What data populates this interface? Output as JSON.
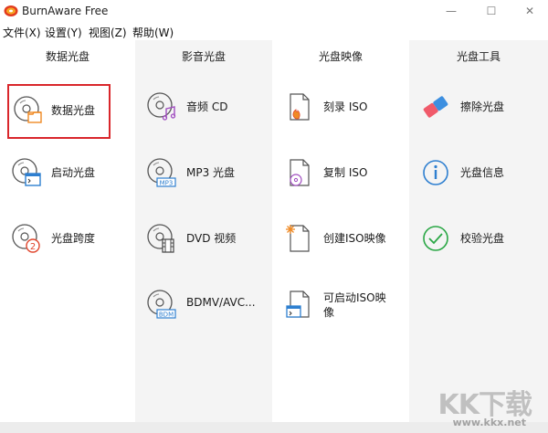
{
  "window": {
    "title": "BurnAware Free"
  },
  "window_controls": {
    "minimize": "—",
    "maximize": "☐",
    "close": "✕"
  },
  "menu": [
    "文件(X)",
    "设置(Y)",
    "视图(Z)",
    "帮助(W)"
  ],
  "columns": [
    {
      "header": "数据光盘",
      "tiles": [
        {
          "label": "数据光盘",
          "icon": "disc-folder-icon",
          "selected": true
        },
        {
          "label": "启动光盘",
          "icon": "disc-terminal-icon",
          "selected": false
        },
        {
          "label": "光盘跨度",
          "icon": "disc-span-icon",
          "selected": false
        }
      ]
    },
    {
      "header": "影音光盘",
      "tiles": [
        {
          "label": "音频 CD",
          "icon": "disc-music-icon"
        },
        {
          "label": "MP3 光盘",
          "icon": "disc-mp3-icon"
        },
        {
          "label": "DVD 视频",
          "icon": "disc-film-icon"
        },
        {
          "label": "BDMV/AVC...",
          "icon": "disc-bdm-icon"
        }
      ]
    },
    {
      "header": "光盘映像",
      "tiles": [
        {
          "label": "刻录 ISO",
          "icon": "iso-burn-icon"
        },
        {
          "label": "复制 ISO",
          "icon": "iso-copy-icon"
        },
        {
          "label": "创建ISO映像",
          "icon": "iso-create-icon"
        },
        {
          "label": "可启动ISO映像",
          "icon": "iso-bootable-icon"
        }
      ]
    },
    {
      "header": "光盘工具",
      "tiles": [
        {
          "label": "擦除光盘",
          "icon": "eraser-icon"
        },
        {
          "label": "光盘信息",
          "icon": "info-icon"
        },
        {
          "label": "校验光盘",
          "icon": "check-circle-icon"
        }
      ]
    }
  ],
  "watermark": {
    "logo": "KK下载",
    "url": "www.kkx.net"
  },
  "colors": {
    "column_alt_bg": "#f4f4f4",
    "selection_border": "#d9262b",
    "accent_blue": "#2e7fd0",
    "accent_orange": "#f08a24"
  }
}
